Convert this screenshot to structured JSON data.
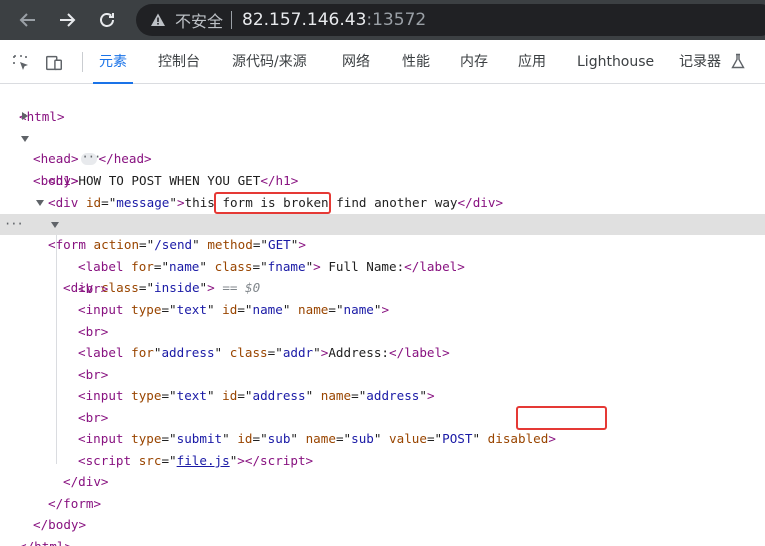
{
  "browser": {
    "security_label": "不安全",
    "host": "82.157.146.43",
    "port": ":13572",
    "icons": [
      "back-arrow-icon",
      "forward-arrow-icon",
      "reload-icon",
      "warning-icon"
    ]
  },
  "devtools": {
    "tabs": [
      {
        "label": "元素",
        "active": true
      },
      {
        "label": "控制台"
      },
      {
        "label": "源代码/来源"
      },
      {
        "label": "网络"
      },
      {
        "label": "性能"
      },
      {
        "label": "内存"
      },
      {
        "label": "应用"
      },
      {
        "label": "Lighthouse"
      },
      {
        "label": "记录器"
      }
    ]
  },
  "dom": {
    "html_open": "html",
    "head": "head",
    "body": "body",
    "h1_tag": "h1",
    "h1_text": "HOW TO POST WHEN YOU GET",
    "div_tag": "div",
    "id_attr": "id",
    "message_id": "message",
    "message_text": "this form is broken find another way",
    "form_tag": "form",
    "action_attr": "action",
    "action_val": "/send",
    "method_attr": "method",
    "method_val": "GET",
    "class_attr": "class",
    "inside_val": "inside",
    "selected_marker": "== $0",
    "label_tag": "label",
    "for_attr": "for",
    "name_val": "name",
    "fname_val": "fname",
    "fullname_text": " Full Name:",
    "br_tag": "br",
    "input_tag": "input",
    "type_attr": "type",
    "text_val": "text",
    "name_attr": "name",
    "address_val": "address",
    "addr_val": "addr",
    "address_text": "Address:",
    "submit_val": "submit",
    "sub_val": "sub",
    "value_attr": "value",
    "post_val": "POST",
    "disabled_attr": "disabled",
    "script_tag": "script",
    "src_attr": "src",
    "src_val": "file.js"
  }
}
